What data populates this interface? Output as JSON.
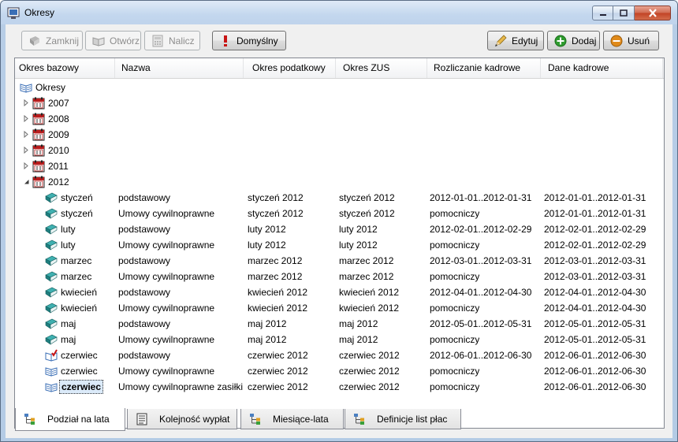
{
  "window": {
    "title": "Okresy",
    "controls": [
      "minimize",
      "maximize",
      "close"
    ]
  },
  "toolbar": {
    "close_label": "Zamknij",
    "open_label": "Otwórz",
    "accrue_label": "Nalicz",
    "default_label": "Domyślny",
    "edit_label": "Edytuj",
    "add_label": "Dodaj",
    "delete_label": "Usuń"
  },
  "columns": [
    "Okres bazowy",
    "Nazwa",
    "Okres podatkowy",
    "Okres ZUS",
    "Rozliczanie kadrowe",
    "Dane kadrowe"
  ],
  "tree": {
    "root": "Okresy",
    "years": [
      "2007",
      "2008",
      "2009",
      "2010",
      "2011",
      "2012"
    ],
    "expanded_year": "2012"
  },
  "periods": [
    {
      "base": "styczeń",
      "name": "podstawowy",
      "tax": "styczeń 2012",
      "zus": "styczeń 2012",
      "hr": "2012-01-01..2012-01-31",
      "data": "2012-01-01..2012-01-31",
      "state": "closed"
    },
    {
      "base": "styczeń",
      "name": "Umowy cywilnoprawne",
      "tax": "styczeń 2012",
      "zus": "styczeń 2012",
      "hr": "pomocniczy",
      "data": "2012-01-01..2012-01-31",
      "state": "closed"
    },
    {
      "base": "luty",
      "name": "podstawowy",
      "tax": "luty 2012",
      "zus": "luty 2012",
      "hr": "2012-02-01..2012-02-29",
      "data": "2012-02-01..2012-02-29",
      "state": "closed"
    },
    {
      "base": "luty",
      "name": "Umowy cywilnoprawne",
      "tax": "luty 2012",
      "zus": "luty 2012",
      "hr": "pomocniczy",
      "data": "2012-02-01..2012-02-29",
      "state": "closed"
    },
    {
      "base": "marzec",
      "name": "podstawowy",
      "tax": "marzec 2012",
      "zus": "marzec 2012",
      "hr": "2012-03-01..2012-03-31",
      "data": "2012-03-01..2012-03-31",
      "state": "closed"
    },
    {
      "base": "marzec",
      "name": "Umowy cywilnoprawne",
      "tax": "marzec 2012",
      "zus": "marzec 2012",
      "hr": "pomocniczy",
      "data": "2012-03-01..2012-03-31",
      "state": "closed"
    },
    {
      "base": "kwiecień",
      "name": "podstawowy",
      "tax": "kwiecień 2012",
      "zus": "kwiecień 2012",
      "hr": "2012-04-01..2012-04-30",
      "data": "2012-04-01..2012-04-30",
      "state": "closed"
    },
    {
      "base": "kwiecień",
      "name": "Umowy cywilnoprawne",
      "tax": "kwiecień 2012",
      "zus": "kwiecień 2012",
      "hr": "pomocniczy",
      "data": "2012-04-01..2012-04-30",
      "state": "closed"
    },
    {
      "base": "maj",
      "name": "podstawowy",
      "tax": "maj 2012",
      "zus": "maj 2012",
      "hr": "2012-05-01..2012-05-31",
      "data": "2012-05-01..2012-05-31",
      "state": "closed"
    },
    {
      "base": "maj",
      "name": "Umowy cywilnoprawne",
      "tax": "maj 2012",
      "zus": "maj 2012",
      "hr": "pomocniczy",
      "data": "2012-05-01..2012-05-31",
      "state": "closed"
    },
    {
      "base": "czerwiec",
      "name": "podstawowy",
      "tax": "czerwiec 2012",
      "zus": "czerwiec 2012",
      "hr": "2012-06-01..2012-06-30",
      "data": "2012-06-01..2012-06-30",
      "state": "default"
    },
    {
      "base": "czerwiec",
      "name": "Umowy cywilnoprawne",
      "tax": "czerwiec 2012",
      "zus": "czerwiec 2012",
      "hr": "pomocniczy",
      "data": "2012-06-01..2012-06-30",
      "state": "open"
    },
    {
      "base": "czerwiec",
      "name": "Umowy cywilnoprawne zasiłki",
      "tax": "czerwiec 2012",
      "zus": "czerwiec 2012",
      "hr": "pomocniczy",
      "data": "2012-06-01..2012-06-30",
      "state": "open",
      "selected": true
    }
  ],
  "tabs": [
    {
      "label": "Podział na lata",
      "active": true,
      "icon": "tree-icon"
    },
    {
      "label": "Kolejność wypłat",
      "active": false,
      "icon": "list-icon"
    },
    {
      "label": "Miesiące-lata",
      "active": false,
      "icon": "tree-icon"
    },
    {
      "label": "Definicje list płac",
      "active": false,
      "icon": "tree-icon"
    }
  ],
  "colors": {
    "book_closed": "#1f8a8a",
    "book_open": "#3b6fb6",
    "calendar_red": "#b81d1d",
    "add_green": "#2e9b2e",
    "delete_orange": "#e08a1a"
  }
}
